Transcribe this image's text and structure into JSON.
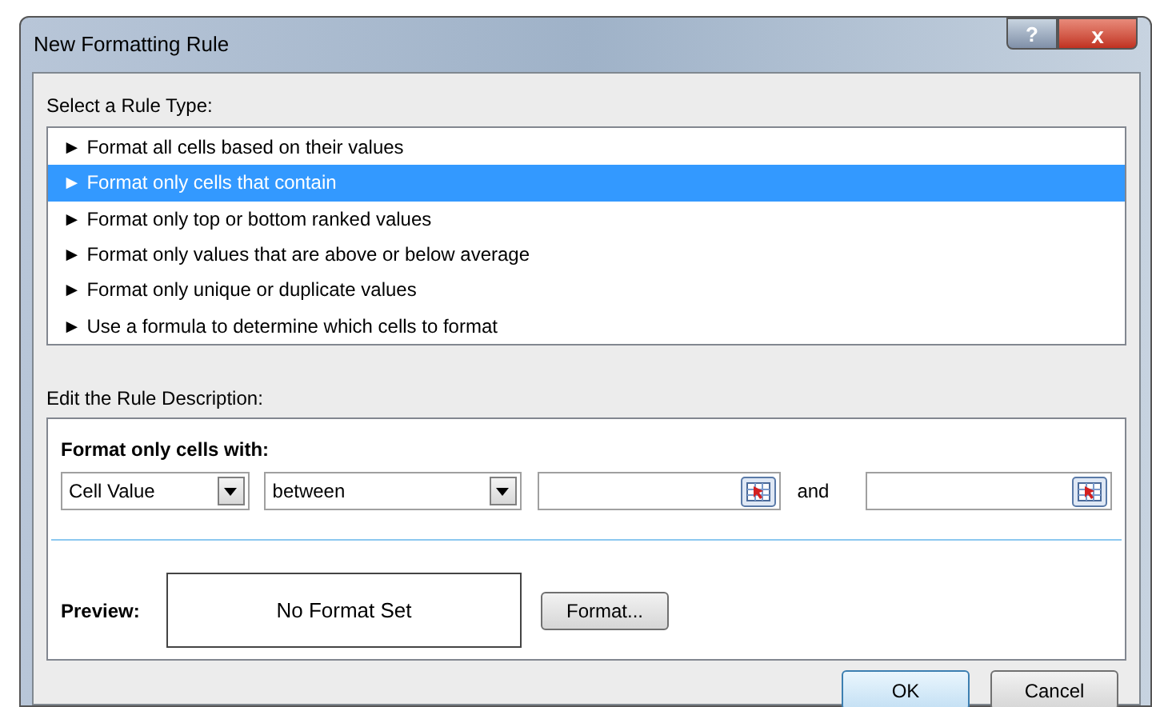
{
  "window": {
    "title": "New Formatting Rule",
    "buttons": [
      "?",
      "x"
    ]
  },
  "rule_type": {
    "label": "Select a Rule Type:",
    "items": [
      {
        "label": "► Format all cells based on their values",
        "selected": false
      },
      {
        "label": "► Format only cells that contain",
        "selected": true
      },
      {
        "label": "► Format only top or bottom ranked values",
        "selected": false
      },
      {
        "label": "► Format only values that are above or below average",
        "selected": false
      },
      {
        "label": "► Format only unique or duplicate values",
        "selected": false
      },
      {
        "label": "► Use a formula to determine which cells to format",
        "selected": false
      }
    ]
  },
  "description": {
    "label": "Edit the Rule Description:",
    "heading": "Format only cells with:",
    "condition": {
      "kind_value": "Cell Value",
      "operator": "between",
      "joiner": "and"
    },
    "preview": {
      "label": "Preview:",
      "text": "No Format Set",
      "button": "Format..."
    }
  },
  "buttons": [
    "OK",
    "Cancel"
  ]
}
